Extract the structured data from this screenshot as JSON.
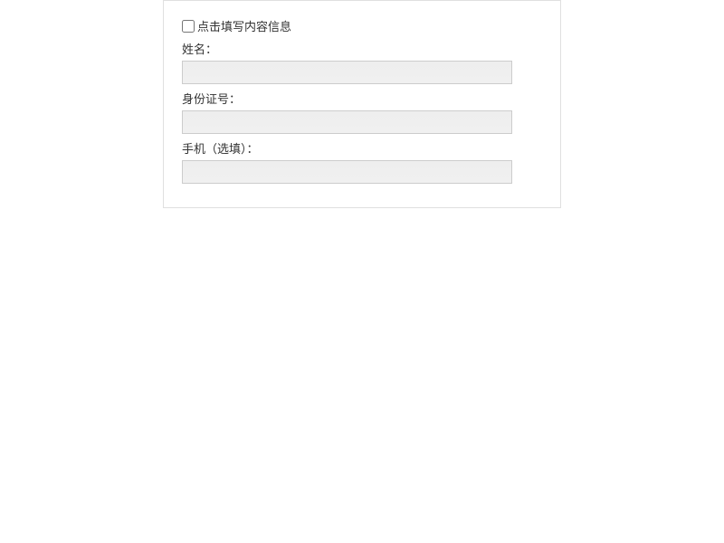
{
  "form": {
    "checkbox_label": "点击填写内容信息",
    "fields": [
      {
        "label": "姓名：",
        "value": ""
      },
      {
        "label": "身份证号：",
        "value": ""
      },
      {
        "label": "手机（选填）：",
        "value": ""
      }
    ]
  }
}
